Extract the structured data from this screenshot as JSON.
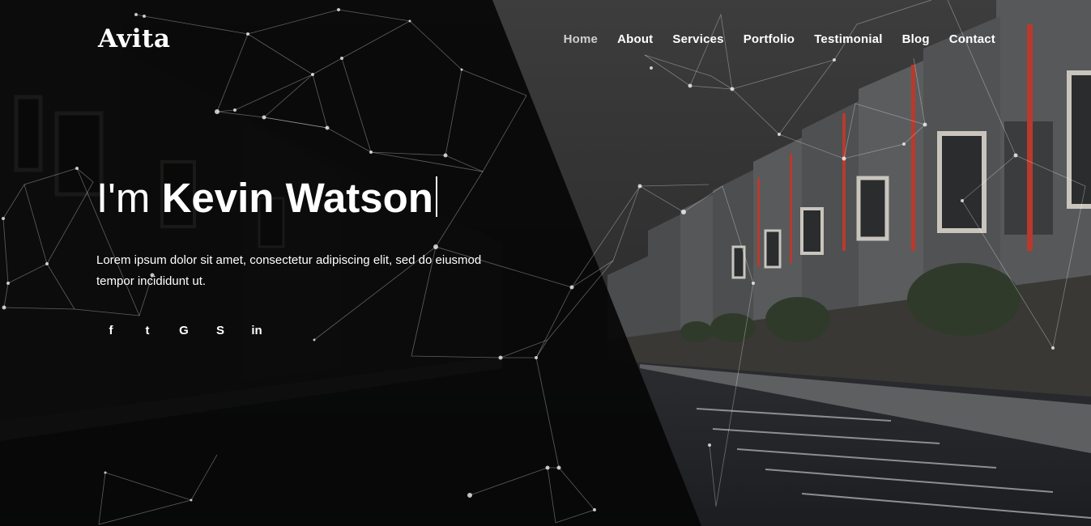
{
  "brand": {
    "logo": "Avita"
  },
  "nav": {
    "items": [
      {
        "label": "Home",
        "active": true
      },
      {
        "label": "About"
      },
      {
        "label": "Services"
      },
      {
        "label": "Portfolio"
      },
      {
        "label": "Testimonial"
      },
      {
        "label": "Blog"
      },
      {
        "label": "Contact"
      }
    ]
  },
  "hero": {
    "greeting": "I'm",
    "name": "Kevin Watson",
    "text": "Lorem ipsum dolor sit amet, consectetur adipiscing elit, sed do eiusmod tempor incididunt ut."
  },
  "social": {
    "icons": [
      {
        "name": "facebook-icon",
        "glyph": "f"
      },
      {
        "name": "twitter-icon",
        "glyph": "t"
      },
      {
        "name": "google-icon",
        "glyph": "G"
      },
      {
        "name": "skype-icon",
        "glyph": "S"
      },
      {
        "name": "linkedin-icon",
        "glyph": "in"
      }
    ]
  },
  "colors": {
    "overlay": "#050505",
    "text": "#ffffff",
    "nav_active": "#cfcfcf",
    "building_accent": "#b83a2c"
  }
}
